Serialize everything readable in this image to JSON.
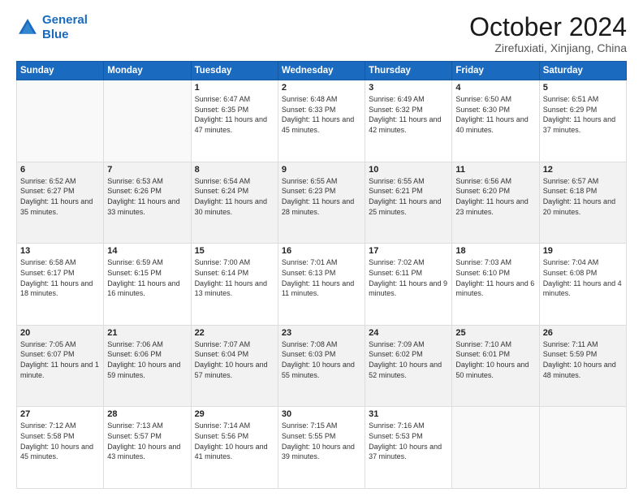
{
  "logo": {
    "line1": "General",
    "line2": "Blue"
  },
  "title": "October 2024",
  "subtitle": "Zirefuxiati, Xinjiang, China",
  "headers": [
    "Sunday",
    "Monday",
    "Tuesday",
    "Wednesday",
    "Thursday",
    "Friday",
    "Saturday"
  ],
  "weeks": [
    {
      "shade": false,
      "days": [
        {
          "num": "",
          "info": ""
        },
        {
          "num": "",
          "info": ""
        },
        {
          "num": "1",
          "info": "Sunrise: 6:47 AM\nSunset: 6:35 PM\nDaylight: 11 hours and 47 minutes."
        },
        {
          "num": "2",
          "info": "Sunrise: 6:48 AM\nSunset: 6:33 PM\nDaylight: 11 hours and 45 minutes."
        },
        {
          "num": "3",
          "info": "Sunrise: 6:49 AM\nSunset: 6:32 PM\nDaylight: 11 hours and 42 minutes."
        },
        {
          "num": "4",
          "info": "Sunrise: 6:50 AM\nSunset: 6:30 PM\nDaylight: 11 hours and 40 minutes."
        },
        {
          "num": "5",
          "info": "Sunrise: 6:51 AM\nSunset: 6:29 PM\nDaylight: 11 hours and 37 minutes."
        }
      ]
    },
    {
      "shade": true,
      "days": [
        {
          "num": "6",
          "info": "Sunrise: 6:52 AM\nSunset: 6:27 PM\nDaylight: 11 hours and 35 minutes."
        },
        {
          "num": "7",
          "info": "Sunrise: 6:53 AM\nSunset: 6:26 PM\nDaylight: 11 hours and 33 minutes."
        },
        {
          "num": "8",
          "info": "Sunrise: 6:54 AM\nSunset: 6:24 PM\nDaylight: 11 hours and 30 minutes."
        },
        {
          "num": "9",
          "info": "Sunrise: 6:55 AM\nSunset: 6:23 PM\nDaylight: 11 hours and 28 minutes."
        },
        {
          "num": "10",
          "info": "Sunrise: 6:55 AM\nSunset: 6:21 PM\nDaylight: 11 hours and 25 minutes."
        },
        {
          "num": "11",
          "info": "Sunrise: 6:56 AM\nSunset: 6:20 PM\nDaylight: 11 hours and 23 minutes."
        },
        {
          "num": "12",
          "info": "Sunrise: 6:57 AM\nSunset: 6:18 PM\nDaylight: 11 hours and 20 minutes."
        }
      ]
    },
    {
      "shade": false,
      "days": [
        {
          "num": "13",
          "info": "Sunrise: 6:58 AM\nSunset: 6:17 PM\nDaylight: 11 hours and 18 minutes."
        },
        {
          "num": "14",
          "info": "Sunrise: 6:59 AM\nSunset: 6:15 PM\nDaylight: 11 hours and 16 minutes."
        },
        {
          "num": "15",
          "info": "Sunrise: 7:00 AM\nSunset: 6:14 PM\nDaylight: 11 hours and 13 minutes."
        },
        {
          "num": "16",
          "info": "Sunrise: 7:01 AM\nSunset: 6:13 PM\nDaylight: 11 hours and 11 minutes."
        },
        {
          "num": "17",
          "info": "Sunrise: 7:02 AM\nSunset: 6:11 PM\nDaylight: 11 hours and 9 minutes."
        },
        {
          "num": "18",
          "info": "Sunrise: 7:03 AM\nSunset: 6:10 PM\nDaylight: 11 hours and 6 minutes."
        },
        {
          "num": "19",
          "info": "Sunrise: 7:04 AM\nSunset: 6:08 PM\nDaylight: 11 hours and 4 minutes."
        }
      ]
    },
    {
      "shade": true,
      "days": [
        {
          "num": "20",
          "info": "Sunrise: 7:05 AM\nSunset: 6:07 PM\nDaylight: 11 hours and 1 minute."
        },
        {
          "num": "21",
          "info": "Sunrise: 7:06 AM\nSunset: 6:06 PM\nDaylight: 10 hours and 59 minutes."
        },
        {
          "num": "22",
          "info": "Sunrise: 7:07 AM\nSunset: 6:04 PM\nDaylight: 10 hours and 57 minutes."
        },
        {
          "num": "23",
          "info": "Sunrise: 7:08 AM\nSunset: 6:03 PM\nDaylight: 10 hours and 55 minutes."
        },
        {
          "num": "24",
          "info": "Sunrise: 7:09 AM\nSunset: 6:02 PM\nDaylight: 10 hours and 52 minutes."
        },
        {
          "num": "25",
          "info": "Sunrise: 7:10 AM\nSunset: 6:01 PM\nDaylight: 10 hours and 50 minutes."
        },
        {
          "num": "26",
          "info": "Sunrise: 7:11 AM\nSunset: 5:59 PM\nDaylight: 10 hours and 48 minutes."
        }
      ]
    },
    {
      "shade": false,
      "days": [
        {
          "num": "27",
          "info": "Sunrise: 7:12 AM\nSunset: 5:58 PM\nDaylight: 10 hours and 45 minutes."
        },
        {
          "num": "28",
          "info": "Sunrise: 7:13 AM\nSunset: 5:57 PM\nDaylight: 10 hours and 43 minutes."
        },
        {
          "num": "29",
          "info": "Sunrise: 7:14 AM\nSunset: 5:56 PM\nDaylight: 10 hours and 41 minutes."
        },
        {
          "num": "30",
          "info": "Sunrise: 7:15 AM\nSunset: 5:55 PM\nDaylight: 10 hours and 39 minutes."
        },
        {
          "num": "31",
          "info": "Sunrise: 7:16 AM\nSunset: 5:53 PM\nDaylight: 10 hours and 37 minutes."
        },
        {
          "num": "",
          "info": ""
        },
        {
          "num": "",
          "info": ""
        }
      ]
    }
  ]
}
